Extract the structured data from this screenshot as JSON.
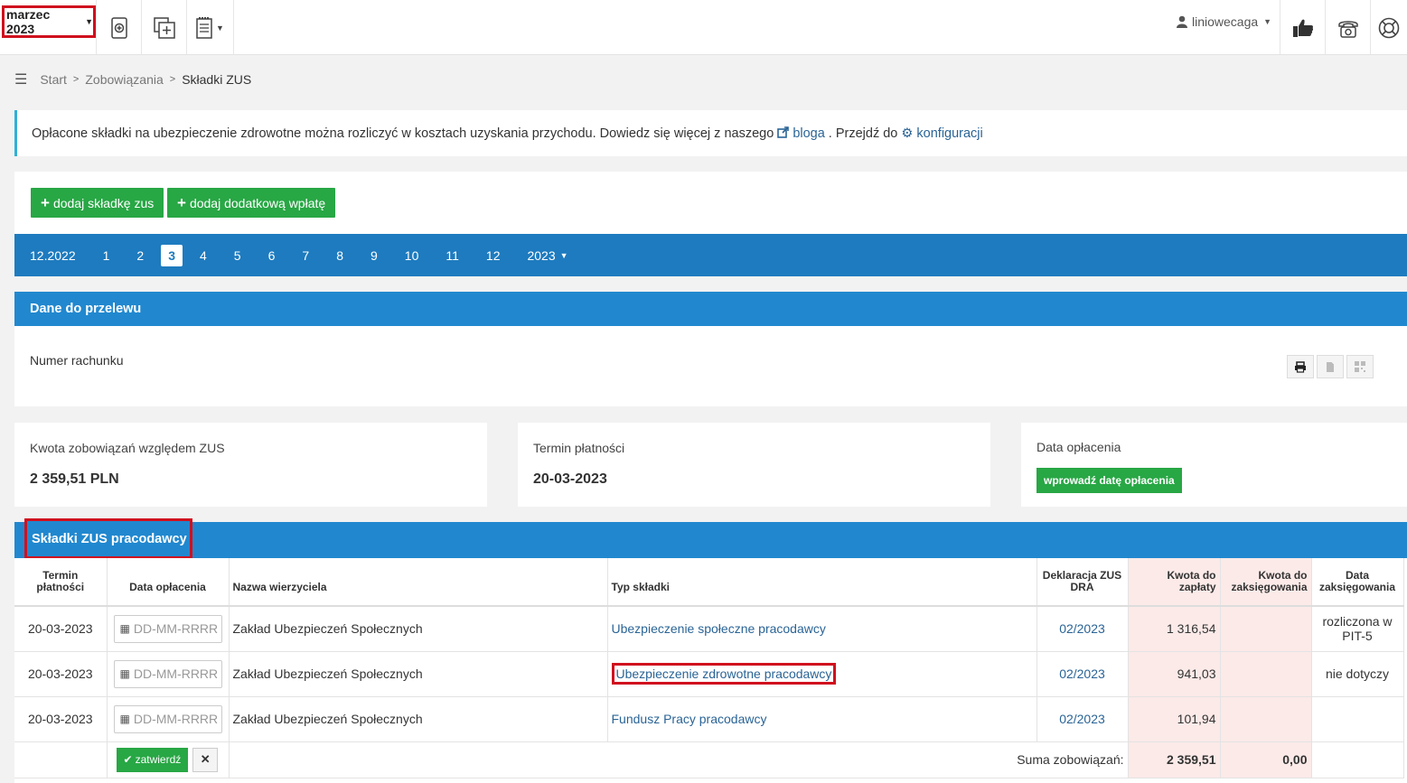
{
  "topbar": {
    "period": "marzec 2023",
    "user": "liniowecaga"
  },
  "breadcrumb": {
    "start": "Start",
    "middle": "Zobowiązania",
    "current": "Składki ZUS"
  },
  "info": {
    "text": "Opłacone składki na ubezpieczenie zdrowotne można rozliczyć w kosztach uzyskania przychodu. Dowiedz się więcej z naszego",
    "blog_link": "bloga",
    "middle": ". Przejdź do",
    "config_link": "konfiguracji"
  },
  "actions": {
    "add_zus": "dodaj składkę zus",
    "add_extra": "dodaj dodatkową wpłatę"
  },
  "months": {
    "prev": "12.2022",
    "items": [
      "1",
      "2",
      "3",
      "4",
      "5",
      "6",
      "7",
      "8",
      "9",
      "10",
      "11",
      "12"
    ],
    "active": "3",
    "year": "2023"
  },
  "transfer": {
    "title": "Dane do przelewu",
    "account_label": "Numer rachunku"
  },
  "cards": {
    "amount_title": "Kwota zobowiązań względem ZUS",
    "amount_value": "2 359,51 PLN",
    "due_title": "Termin płatności",
    "due_value": "20-03-2023",
    "paid_title": "Data opłacenia",
    "paid_button": "wprowadź datę opłacenia"
  },
  "table": {
    "title": "Składki ZUS pracodawcy",
    "headers": {
      "due": "Termin płatności",
      "paid_date": "Data opłacenia",
      "creditor": "Nazwa wierzyciela",
      "type": "Typ składki",
      "declaration": "Deklaracja ZUS DRA",
      "amount": "Kwota do zapłaty",
      "booking_amount": "Kwota do zaksięgowania",
      "booking_date": "Data zaksięgowania"
    },
    "date_placeholder": "DD-MM-RRRR",
    "rows": [
      {
        "due": "20-03-2023",
        "creditor": "Zakład Ubezpieczeń Społecznych",
        "type": "Ubezpieczenie społeczne pracodawcy",
        "declaration": "02/2023",
        "amount": "1 316,54",
        "booking_amount": "",
        "booking_date": "rozliczona w PIT-5"
      },
      {
        "due": "20-03-2023",
        "creditor": "Zakład Ubezpieczeń Społecznych",
        "type": "Ubezpieczenie zdrowotne pracodawcy",
        "declaration": "02/2023",
        "amount": "941,03",
        "booking_amount": "",
        "booking_date": "nie dotyczy"
      },
      {
        "due": "20-03-2023",
        "creditor": "Zakład Ubezpieczeń Społecznych",
        "type": "Fundusz Pracy pracodawcy",
        "declaration": "02/2023",
        "amount": "101,94",
        "booking_amount": "",
        "booking_date": ""
      }
    ],
    "confirm": "zatwierdź",
    "sum_label": "Suma zobowiązań:",
    "sum_amount": "2 359,51",
    "sum_booking": "0,00"
  }
}
